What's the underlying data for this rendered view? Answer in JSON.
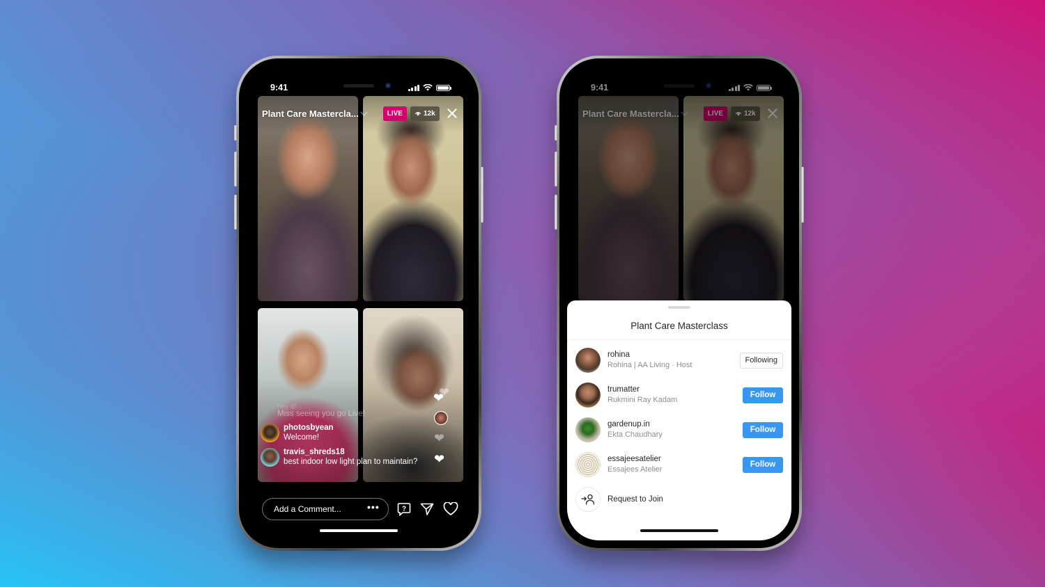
{
  "theme": {
    "live_color": "#d5006c",
    "follow_color": "#3897f0",
    "background_gradient": [
      "#26c4f5",
      "#8a63b4",
      "#d20d6e"
    ]
  },
  "status_bar": {
    "time": "9:41",
    "icons": [
      "signal-icon",
      "wifi-icon",
      "battery-icon"
    ]
  },
  "live": {
    "title": "Plant Care Mastercla...",
    "live_label": "LIVE",
    "viewers": "12k",
    "participants": [
      "rohina",
      "trumatter",
      "gardenup.in",
      "essajeesatelier"
    ]
  },
  "comments": {
    "faded_top": "Hey @...",
    "faded": "Miss seeing you go Live!",
    "items": [
      {
        "user": "photosbyean",
        "text": "Welcome!"
      },
      {
        "user": "travis_shreds18",
        "text": "best indoor low light plan to maintain?"
      }
    ]
  },
  "bottom_bar": {
    "comment_placeholder": "Add a Comment...",
    "more_label": "•••"
  },
  "sheet": {
    "title": "Plant Care Masterclass",
    "people": [
      {
        "username": "rohina",
        "subtitle": "Rohina | AA Living · Host",
        "action": "Following"
      },
      {
        "username": "trumatter",
        "subtitle": "Rukmini Ray Kadam",
        "action": "Follow"
      },
      {
        "username": "gardenup.in",
        "subtitle": "Ekta Chaudhary",
        "action": "Follow"
      },
      {
        "username": "essajeesatelier",
        "subtitle": "Essajees Atelier",
        "action": "Follow"
      }
    ],
    "request_label": "Request to Join"
  }
}
